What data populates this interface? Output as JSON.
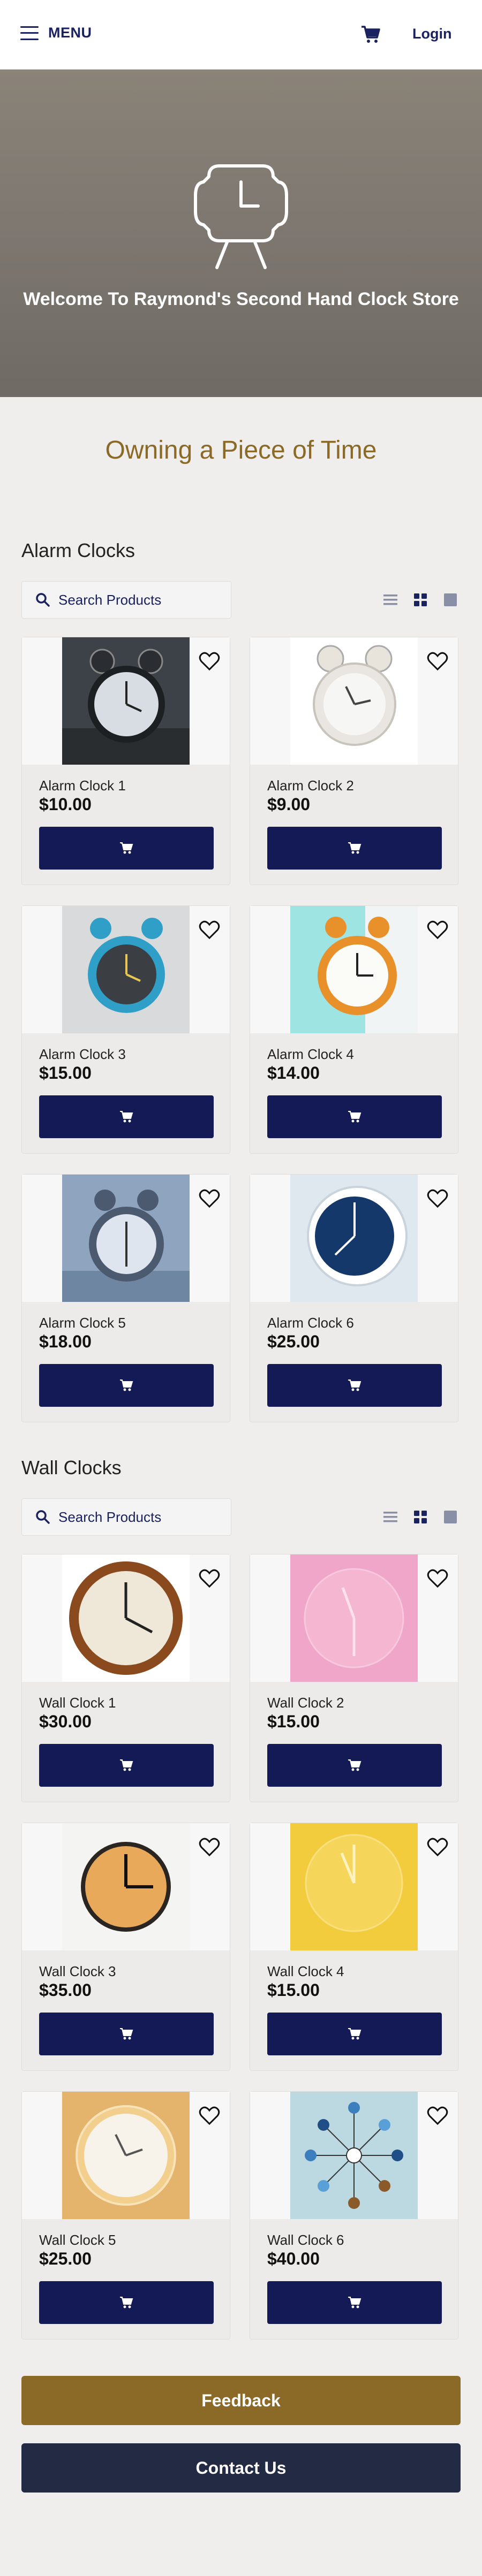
{
  "header": {
    "menu_label": "MENU",
    "login_label": "Login"
  },
  "hero": {
    "title": "Welcome To Raymond's Second Hand Clock Store"
  },
  "tagline": "Owning a Piece of Time",
  "alarm": {
    "title": "Alarm Clocks",
    "search_placeholder": "Search Products",
    "items": [
      {
        "name": "Alarm Clock 1",
        "price": "$10.00"
      },
      {
        "name": "Alarm Clock 2",
        "price": "$9.00"
      },
      {
        "name": "Alarm Clock 3",
        "price": "$15.00"
      },
      {
        "name": "Alarm Clock 4",
        "price": "$14.00"
      },
      {
        "name": "Alarm Clock 5",
        "price": "$18.00"
      },
      {
        "name": "Alarm Clock 6",
        "price": "$25.00"
      }
    ]
  },
  "wall": {
    "title": "Wall Clocks",
    "search_placeholder": "Search Products",
    "items": [
      {
        "name": "Wall Clock 1",
        "price": "$30.00"
      },
      {
        "name": "Wall Clock 2",
        "price": "$15.00"
      },
      {
        "name": "Wall Clock 3",
        "price": "$35.00"
      },
      {
        "name": "Wall Clock 4",
        "price": "$15.00"
      },
      {
        "name": "Wall Clock 5",
        "price": "$25.00"
      },
      {
        "name": "Wall Clock 6",
        "price": "$40.00"
      }
    ]
  },
  "footer": {
    "feedback_label": "Feedback",
    "contact_label": "Contact Us"
  },
  "colors": {
    "brand_navy": "#131a55",
    "gold": "#8a6a26",
    "contact_button": "#222a44"
  },
  "icons": [
    "menu-icon",
    "cart-icon",
    "clock-logo-icon",
    "search-icon",
    "list-view-icon",
    "grid-view-icon",
    "tile-view-icon",
    "heart-icon"
  ]
}
